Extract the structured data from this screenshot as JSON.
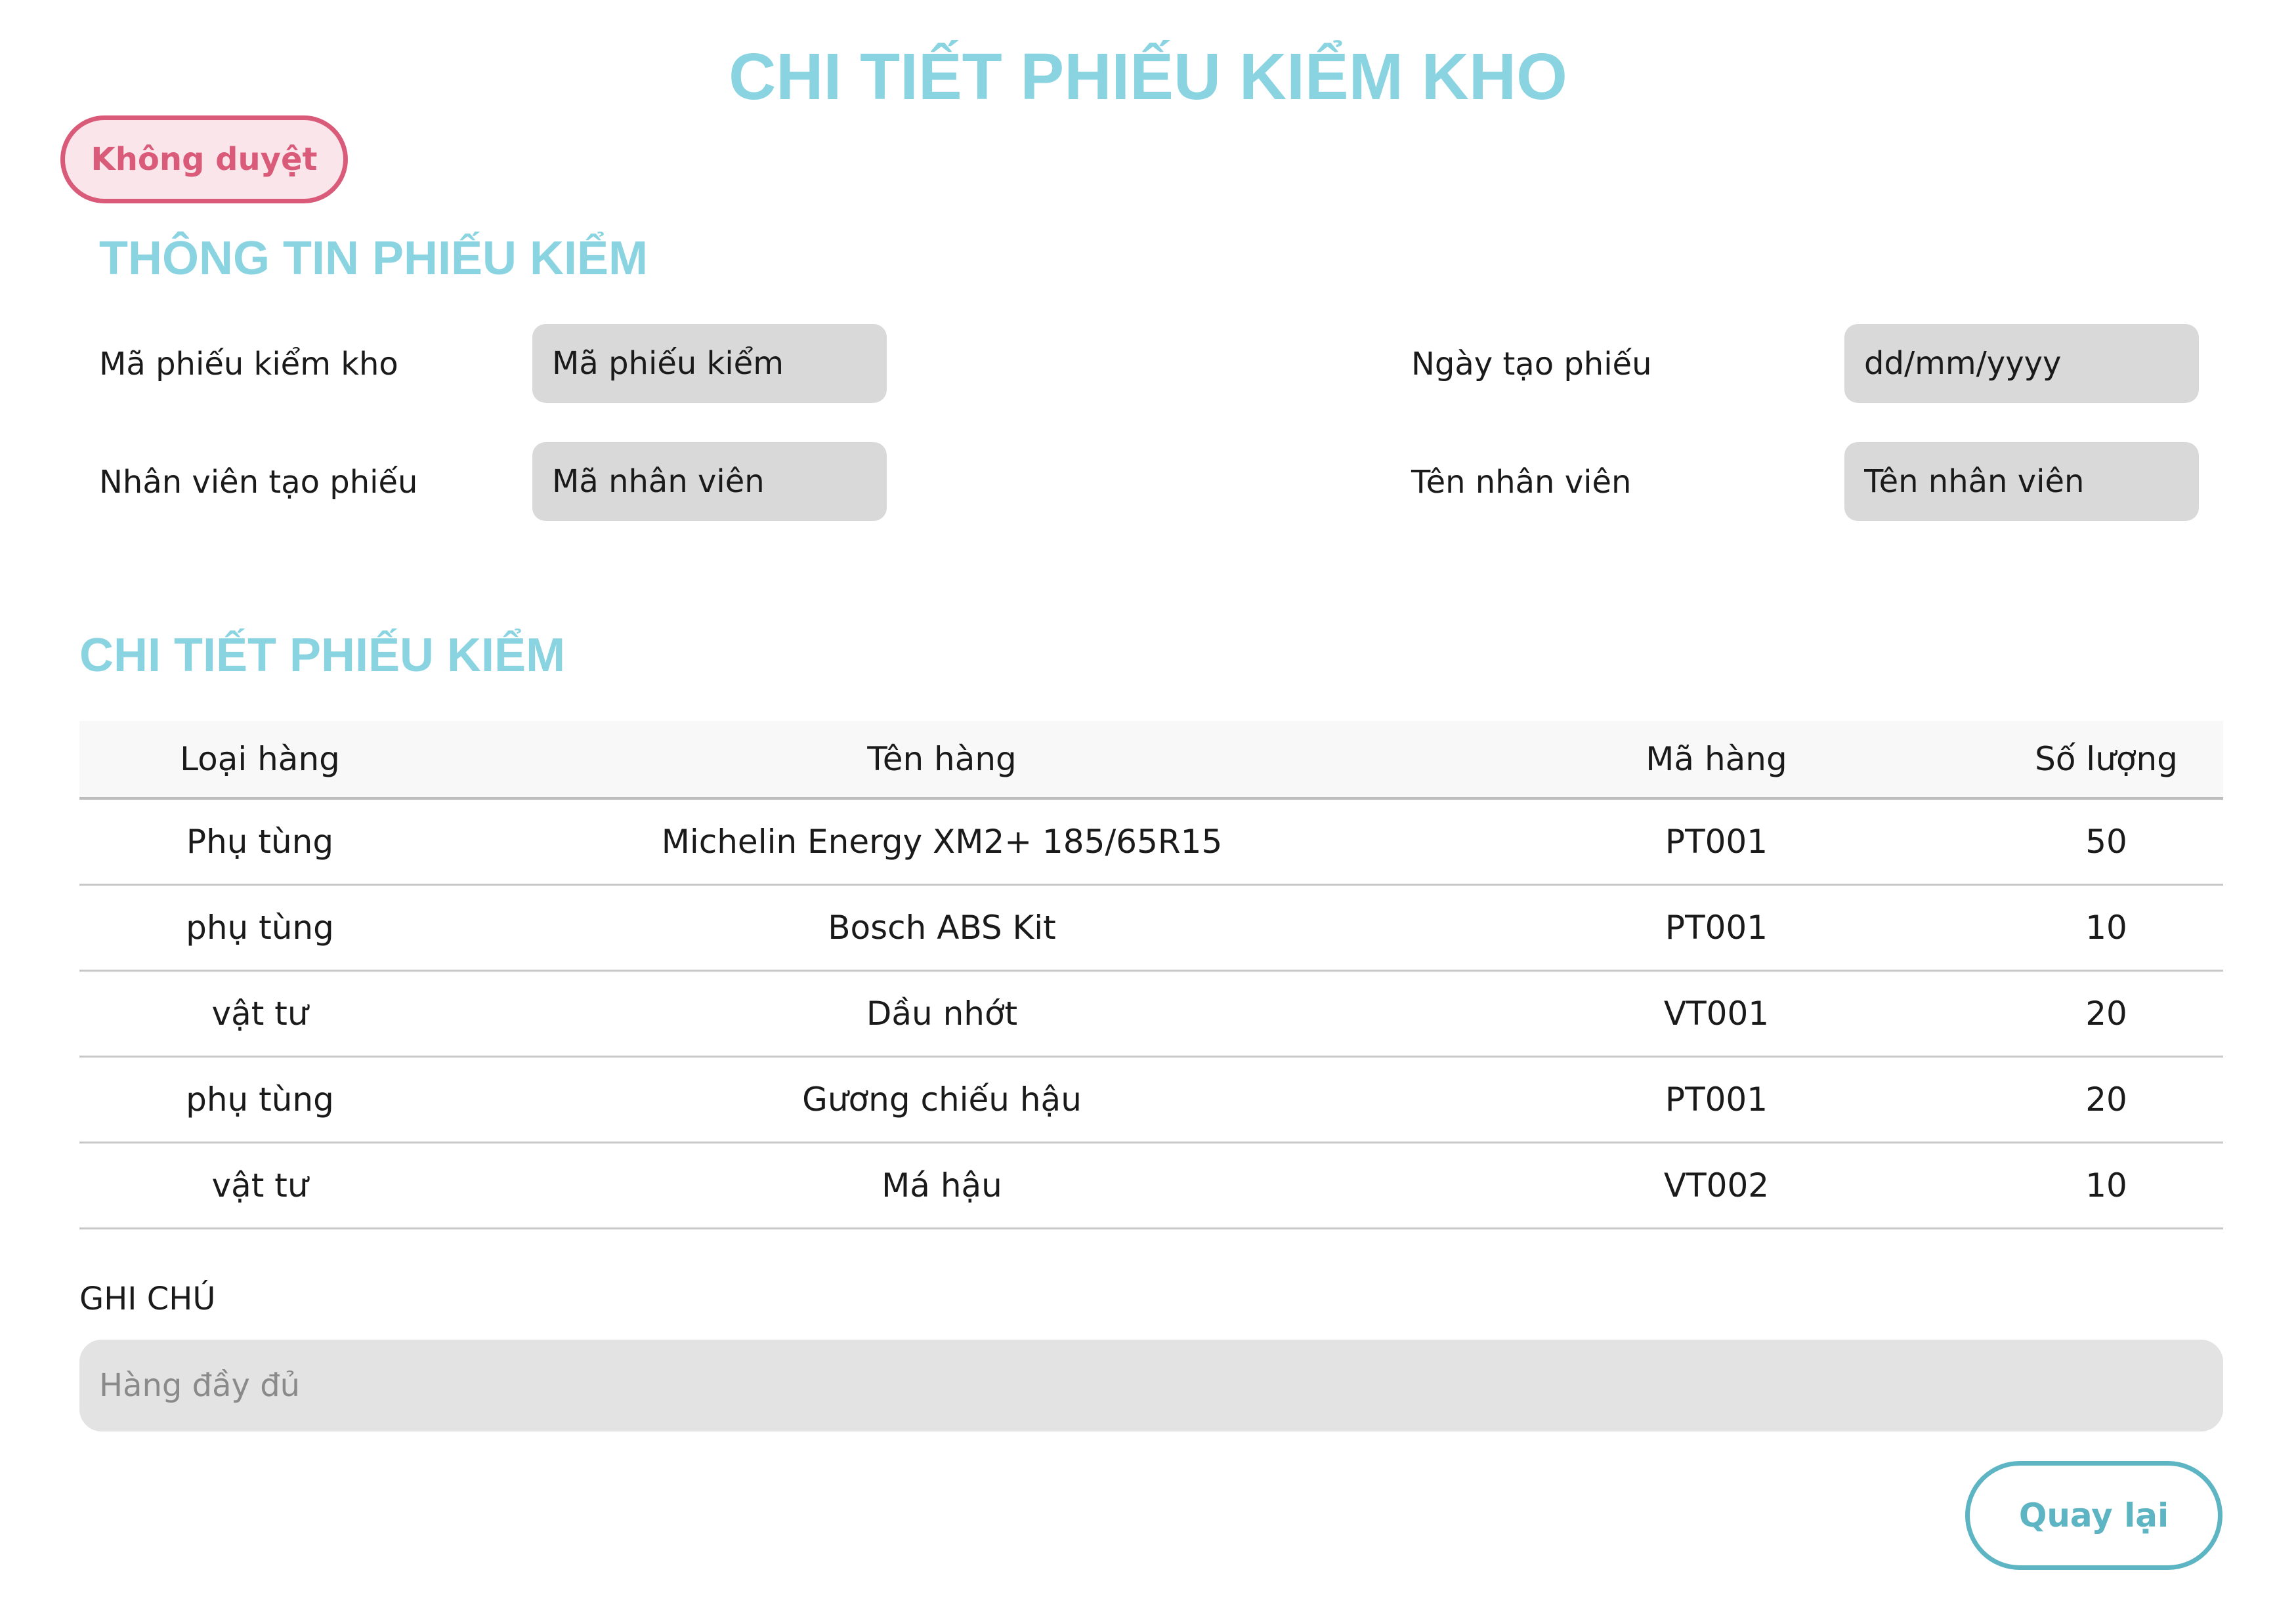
{
  "page_title": "CHI TIẾT PHIẾU KIỂM KHO",
  "status": {
    "label": "Không duyệt",
    "color": "#d95b79",
    "background": "#fae6ea"
  },
  "info_section": {
    "title": "THÔNG TIN PHIẾU KIỂM",
    "fields": {
      "ticket_code": {
        "label": "Mã phiếu kiểm kho",
        "placeholder": "Mã phiếu kiểm"
      },
      "created_date": {
        "label": "Ngày tạo phiếu",
        "placeholder": "dd/mm/yyyy"
      },
      "employee_code": {
        "label": "Nhân viên tạo phiếu",
        "placeholder": "Mã nhân viên"
      },
      "employee_name": {
        "label": "Tên nhân viên",
        "placeholder": "Tên nhân viên"
      }
    }
  },
  "detail_section": {
    "title": "CHI TIẾT PHIẾU KIỂM",
    "columns": [
      "Loại hàng",
      "Tên hàng",
      "Mã hàng",
      "Số lượng"
    ],
    "rows": [
      [
        "Phụ tùng",
        "Michelin Energy XM2+ 185/65R15",
        "PT001",
        "50"
      ],
      [
        "phụ tùng",
        "Bosch ABS Kit",
        "PT001",
        "10"
      ],
      [
        "vật tư",
        "Dầu nhớt",
        "VT001",
        "20"
      ],
      [
        "phụ tùng",
        "Gương chiếu hậu",
        "PT001",
        "20"
      ],
      [
        "vật tư",
        "Má hậu",
        "VT002",
        "10"
      ]
    ]
  },
  "note": {
    "label": "GHI CHÚ",
    "placeholder": "Hàng đầy đủ"
  },
  "back_button": {
    "label": "Quay lại"
  },
  "colors": {
    "accent": "#8ad3e1",
    "button_teal": "#5db4c3",
    "field_bg": "#d9d9d9"
  }
}
